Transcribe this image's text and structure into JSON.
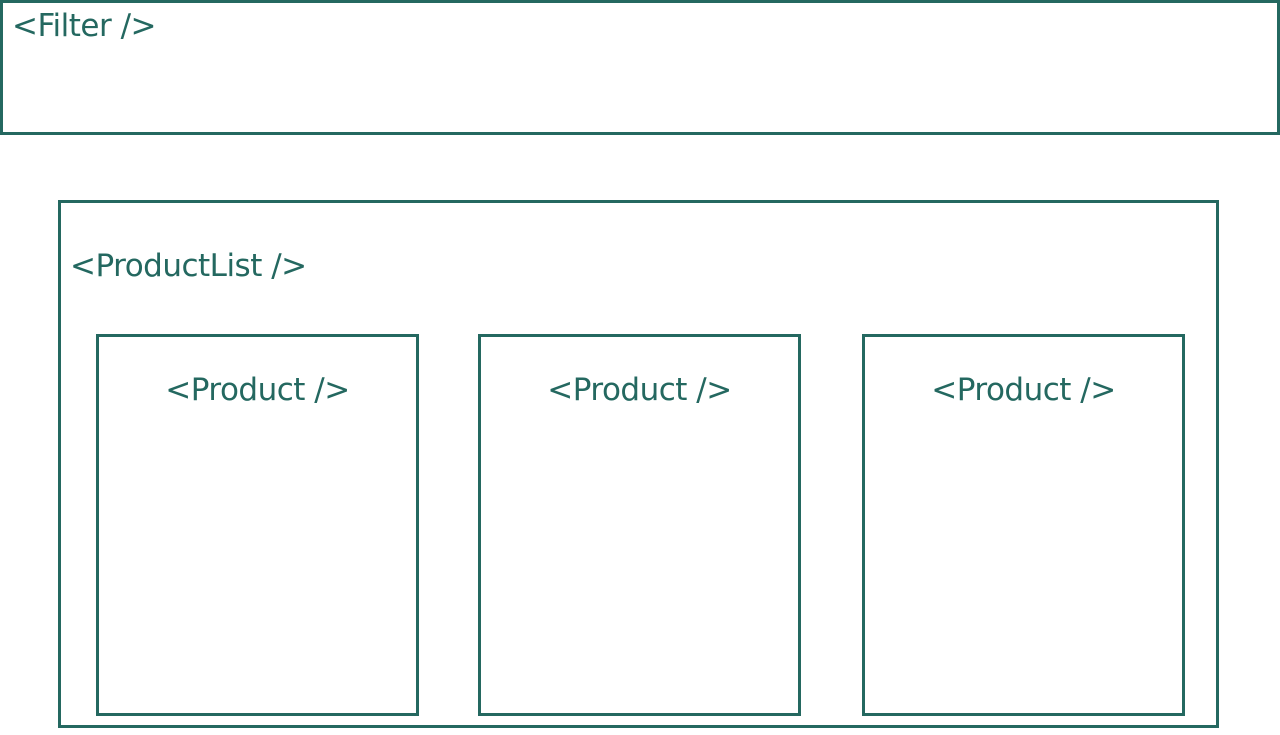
{
  "accent_color": "#246860",
  "background_color": "#ffffff",
  "filter": {
    "label": "<Filter />"
  },
  "product_list": {
    "label": "<ProductList />",
    "products": [
      {
        "label": "<Product />"
      },
      {
        "label": "<Product />"
      },
      {
        "label": "<Product />"
      }
    ]
  }
}
